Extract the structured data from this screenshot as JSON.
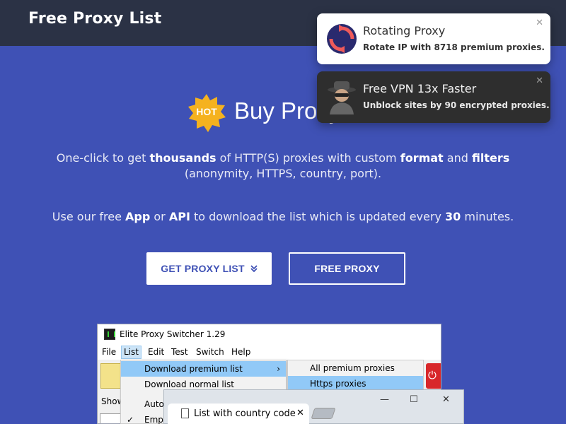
{
  "topbar": {
    "brand": "Free Proxy List"
  },
  "hero": {
    "badge": "HOT",
    "title": "Buy Proxy",
    "desc1": {
      "p1": "One-click to get ",
      "b1": "thousands",
      "p2": " of HTTP(S) proxies with custom ",
      "b2": "format",
      "p3": " and ",
      "b3": "filters",
      "p4": " (anonymity, HTTPS, country, port)."
    },
    "desc2": {
      "p1": "Use our free ",
      "b1": "App",
      "p2": " or ",
      "b2": "API",
      "p3": " to download the list which is updated every ",
      "b3": "30",
      "p4": " minutes."
    },
    "btn_get": "GET PROXY LIST",
    "btn_free": "FREE PROXY"
  },
  "popups": [
    {
      "title": "Rotating Proxy",
      "subtitle": "Rotate IP with 8718 premium proxies.",
      "close": "✕",
      "icon": "rotate-icon"
    },
    {
      "title": "Free VPN 13x Faster",
      "subtitle": "Unblock sites by 90 encrypted proxies.",
      "close": "✕",
      "icon": "spy-icon"
    }
  ],
  "app": {
    "title": "Elite Proxy Switcher 1.29",
    "menu": [
      "File",
      "List",
      "Edit",
      "Test",
      "Switch",
      "Help"
    ],
    "show_label": "Show",
    "dropdown": [
      "Download premium list",
      "Download normal list",
      "Auto",
      "Empt"
    ],
    "submenu": [
      "All premium proxies",
      "Https proxies"
    ]
  },
  "browser": {
    "tab_title": "List with country code",
    "controls": {
      "minimize": "—",
      "maximize": "☐",
      "close": "✕"
    },
    "tab_close": "✕"
  },
  "colors": {
    "hero_bg": "#3f51b5",
    "topbar_bg": "#2b3245",
    "badge": "#f5b21f"
  }
}
